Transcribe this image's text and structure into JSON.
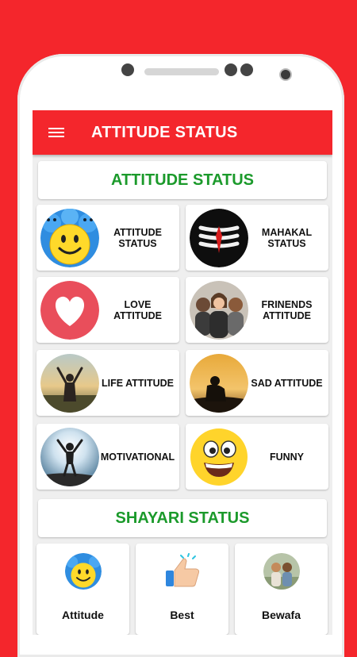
{
  "appbar": {
    "title": "ATTITUDE STATUS"
  },
  "sections": {
    "attitude_header": "ATTITUDE STATUS",
    "shayari_header": "SHAYARI STATUS"
  },
  "tiles": [
    {
      "label": "ATTITUDE STATUS",
      "icon": "smiley-crowd-icon"
    },
    {
      "label": "MAHAKAL STATUS",
      "icon": "tilak-icon"
    },
    {
      "label": "LOVE ATTITUDE",
      "icon": "heart-icon"
    },
    {
      "label": "FRINENDS ATTITUDE",
      "icon": "friends-photo-icon"
    },
    {
      "label": "LIFE ATTITUDE",
      "icon": "sunset-person-icon"
    },
    {
      "label": "SAD ATTITUDE",
      "icon": "sad-person-icon"
    },
    {
      "label": "MOTIVATIONAL",
      "icon": "victory-person-icon"
    },
    {
      "label": "FUNNY",
      "icon": "funny-smiley-icon"
    }
  ],
  "shayari": [
    {
      "label": "Attitude",
      "icon": "smiley-crowd-icon"
    },
    {
      "label": "Best",
      "icon": "thumbs-up-icon"
    },
    {
      "label": "Bewafa",
      "icon": "couple-photo-icon"
    }
  ],
  "colors": {
    "accent": "#f4262c",
    "section_text": "#1b9a2b"
  }
}
